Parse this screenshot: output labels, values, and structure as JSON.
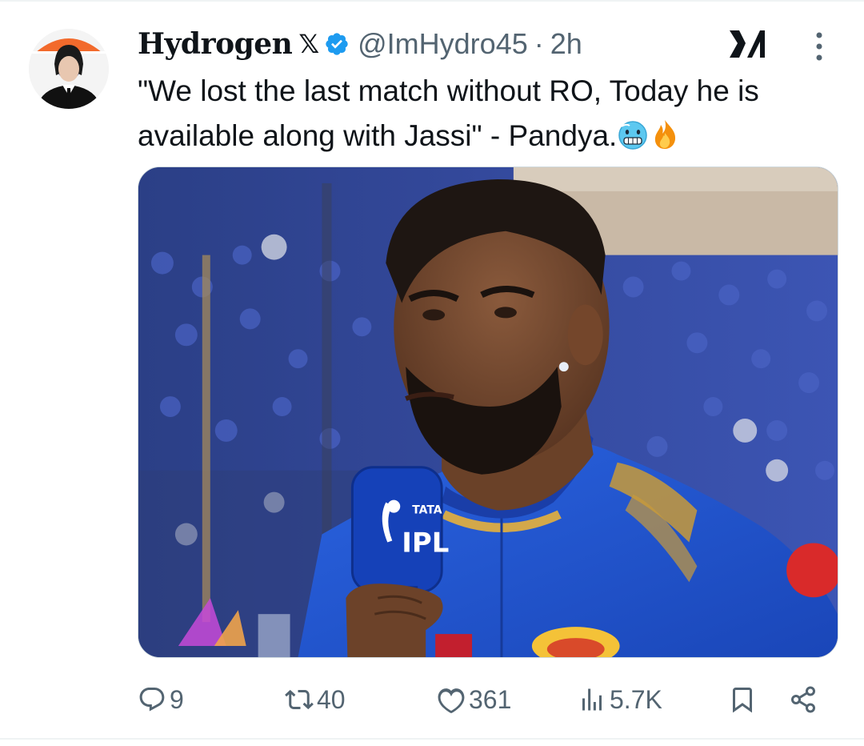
{
  "tweet": {
    "author": {
      "display_name": "Hydrogen",
      "badge": "𝕏",
      "handle": "@ImHydro45",
      "separator": "·",
      "time": "2h",
      "verified": true
    },
    "text": "\"We lost the last match without RO, Today he is available along with Jassi\" - Pandya.",
    "emojis": [
      "cold-face-emoji",
      "fire-emoji"
    ],
    "media": {
      "mic_brand": "TATA",
      "mic_label": "IPL"
    },
    "actions": {
      "replies": "9",
      "retweets": "40",
      "likes": "361",
      "views": "5.7K"
    }
  },
  "colors": {
    "text": "#0f1419",
    "muted": "#536471",
    "verified": "#1d9bf0",
    "jersey": "#1f4fc7"
  }
}
